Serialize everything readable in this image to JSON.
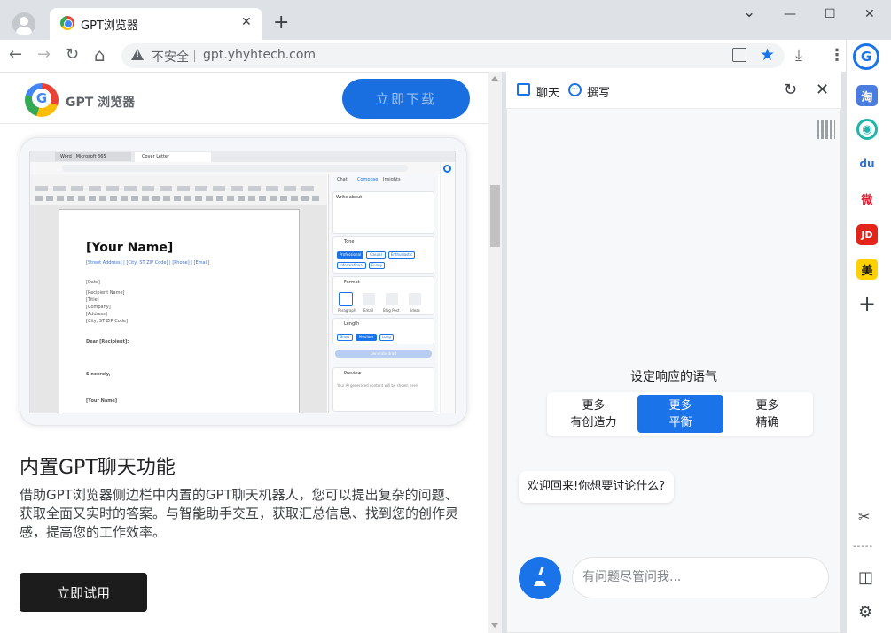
{
  "browser": {
    "tab_title": "GPT浏览器",
    "tab_close": "✕",
    "new_tab": "+",
    "insecure_label": "不安全",
    "url": "gpt.yhyhtech.com",
    "window": {
      "chevron": "⌄",
      "minimize": "—",
      "maximize": "☐",
      "close": "✕"
    },
    "nav": {
      "back": "←",
      "forward": "→",
      "reload": "↻",
      "home": "⌂"
    },
    "download": "⤓",
    "menu": "⋮",
    "star": "★",
    "colors": {
      "accent": "#1a73e8",
      "tabstrip": "#dee1e6"
    }
  },
  "sidebar": {
    "items": [
      {
        "icon": "gpt-browser-icon",
        "label": "G",
        "color": "#1a73e8"
      },
      {
        "icon": "taobao-icon",
        "label": "淘",
        "color": "#4a7de0"
      },
      {
        "icon": "assistant-icon",
        "label": "◉",
        "color": "#1fb5a8"
      },
      {
        "icon": "baidu-icon",
        "label": "du",
        "color": "#2f6fde"
      },
      {
        "icon": "weibo-icon",
        "label": "微",
        "color": "#e6162d"
      },
      {
        "icon": "jd-icon",
        "label": "JD",
        "color": "#e1251b"
      },
      {
        "icon": "meituan-icon",
        "label": "美",
        "color": "#ffd100"
      },
      {
        "icon": "add-icon",
        "label": "+",
        "color": "#3c4043"
      }
    ],
    "bottom": {
      "screenshot": "✂",
      "layout": "◫",
      "settings": "⚙",
      "divider": "-----"
    }
  },
  "page": {
    "site_name": "GPT 浏览器",
    "download_button": "立即下载",
    "heading": "内置GPT聊天功能",
    "body": "借助GPT浏览器侧边栏中内置的GPT聊天机器人，您可以提出复杂的问题、获取全面又实时的答案。与智能助手交互，获取汇总信息、找到您的创作灵感，提高您的工作效率。",
    "try_button": "立即试用",
    "screenshot": {
      "tab1": "Word | Microsoft 365",
      "tab2": "Cover Letter",
      "doc_title": "[Your Name]",
      "doc_lines": [
        "[Street Address] | [City, ST ZIP Code] | [Phone] | [Email]",
        "[Date]",
        "[Recipient Name]",
        "[Title]",
        "[Company]",
        "[Address]",
        "[City, ST ZIP Code]",
        "Dear [Recipient]:",
        "Sincerely,",
        "[Your Name]"
      ],
      "panel_tabs": [
        "Chat",
        "Compose",
        "Insights"
      ],
      "panel_sections": [
        "Write about",
        "Tone",
        "Format",
        "Length",
        "Preview"
      ],
      "tone_options": [
        "Professional",
        "Casual",
        "Enthusiastic",
        "Informational",
        "Funny"
      ],
      "format_options": [
        "Paragraph",
        "Email",
        "Blog Post",
        "Ideas"
      ],
      "length_options": [
        "Short",
        "Medium",
        "Long"
      ],
      "generate_label": "Generate draft",
      "preview_text": "Your AI generated content will be shown here"
    }
  },
  "chat": {
    "tab_chat": "聊天",
    "tab_compose": "撰写",
    "tone_label": "设定响应的语气",
    "tones": [
      {
        "line1": "更多",
        "line2": "有创造力"
      },
      {
        "line1": "更多",
        "line2": "平衡"
      },
      {
        "line1": "更多",
        "line2": "精确"
      }
    ],
    "welcome": "欢迎回来!你想要讨论什么?",
    "input_placeholder": "有问题尽管问我...",
    "refresh": "↻",
    "close": "✕"
  }
}
